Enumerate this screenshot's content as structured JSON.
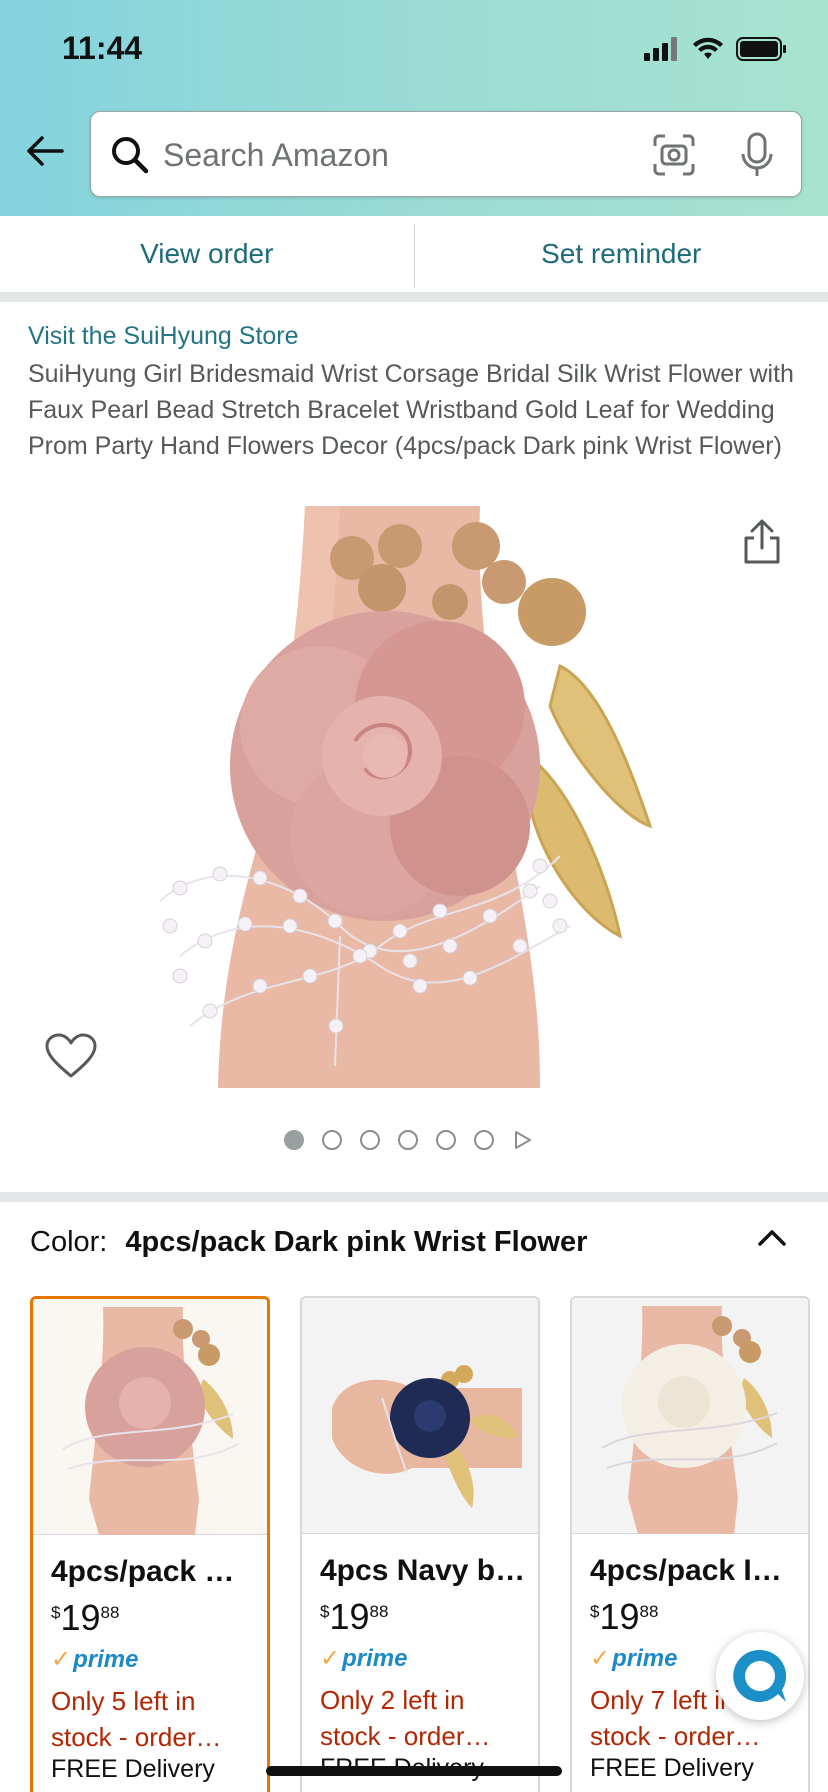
{
  "status_bar": {
    "time": "11:44"
  },
  "search": {
    "placeholder": "Search Amazon"
  },
  "order_bar": {
    "view_order": "View order",
    "set_reminder": "Set reminder"
  },
  "product": {
    "store_link": "Visit the SuiHyung Store",
    "title": "SuiHyung Girl Bridesmaid Wrist Corsage Bridal Silk Wrist Flower with Faux Pearl Bead Stretch Bracelet Wristband Gold Leaf for Wedding Prom Party Hand Flowers Decor (4pcs/pack Dark pink Wrist Flower)",
    "image_count": 6,
    "active_image": 1
  },
  "color_selector": {
    "label": "Color:",
    "value": "4pcs/pack Dark pink Wrist Flower"
  },
  "variants": [
    {
      "name": "4pcs/pack …",
      "price_symbol": "$",
      "price_whole": "19",
      "price_fraction": "88",
      "prime": "prime",
      "stock_line1": "Only 5 left in",
      "stock_line2": "stock - order…",
      "delivery": "FREE Delivery",
      "selected": true,
      "flower_color": "#d9a19b"
    },
    {
      "name": "4pcs Navy b…",
      "price_symbol": "$",
      "price_whole": "19",
      "price_fraction": "88",
      "prime": "prime",
      "stock_line1": "Only 2 left in",
      "stock_line2": "stock - order…",
      "delivery": "FREE Delivery",
      "selected": false,
      "flower_color": "#1f2a55"
    },
    {
      "name": "4pcs/pack I…",
      "price_symbol": "$",
      "price_whole": "19",
      "price_fraction": "88",
      "prime": "prime",
      "stock_line1": "Only 7 left in",
      "stock_line2": "stock - order…",
      "delivery": "FREE Delivery",
      "selected": false,
      "flower_color": "#f4efe4"
    }
  ],
  "colors": {
    "link": "#227486",
    "stock_warning": "#b12704",
    "prime_blue": "#1d89c8",
    "selected_border": "#e77600"
  }
}
